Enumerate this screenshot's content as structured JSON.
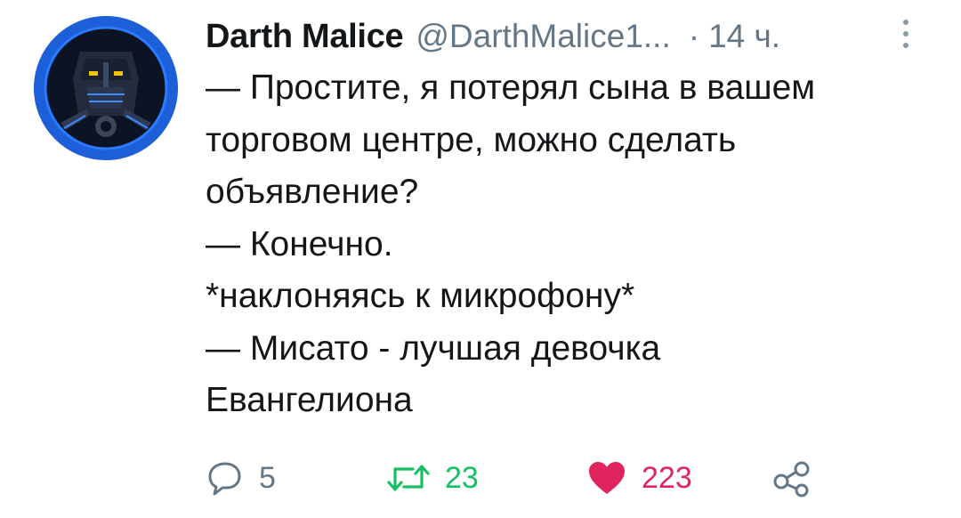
{
  "tweet": {
    "display_name": "Darth Malice",
    "handle": "@DarthMalice1...",
    "separator": "·",
    "time": "14 ч.",
    "lines": [
      "— Простите, я потерял сына в вашем",
      "торговом центре, можно сделать",
      "объявление?",
      "— Конечно.",
      "*наклоняясь к микрофону*",
      "— Мисато - лучшая девочка",
      "Евангелиона"
    ],
    "actions": {
      "reply_count": "5",
      "retweet_count": "23",
      "like_count": "223"
    }
  },
  "icons": {
    "avatar": "avatar-image",
    "more": "more-vertical-icon",
    "reply": "reply-icon",
    "retweet": "retweet-icon",
    "like": "heart-icon",
    "share": "share-icon"
  },
  "colors": {
    "text": "#14171a",
    "muted": "#657786",
    "retweet_active": "#17bf63",
    "like_active": "#e0245e",
    "avatar_ring": "#1d5fd8"
  }
}
